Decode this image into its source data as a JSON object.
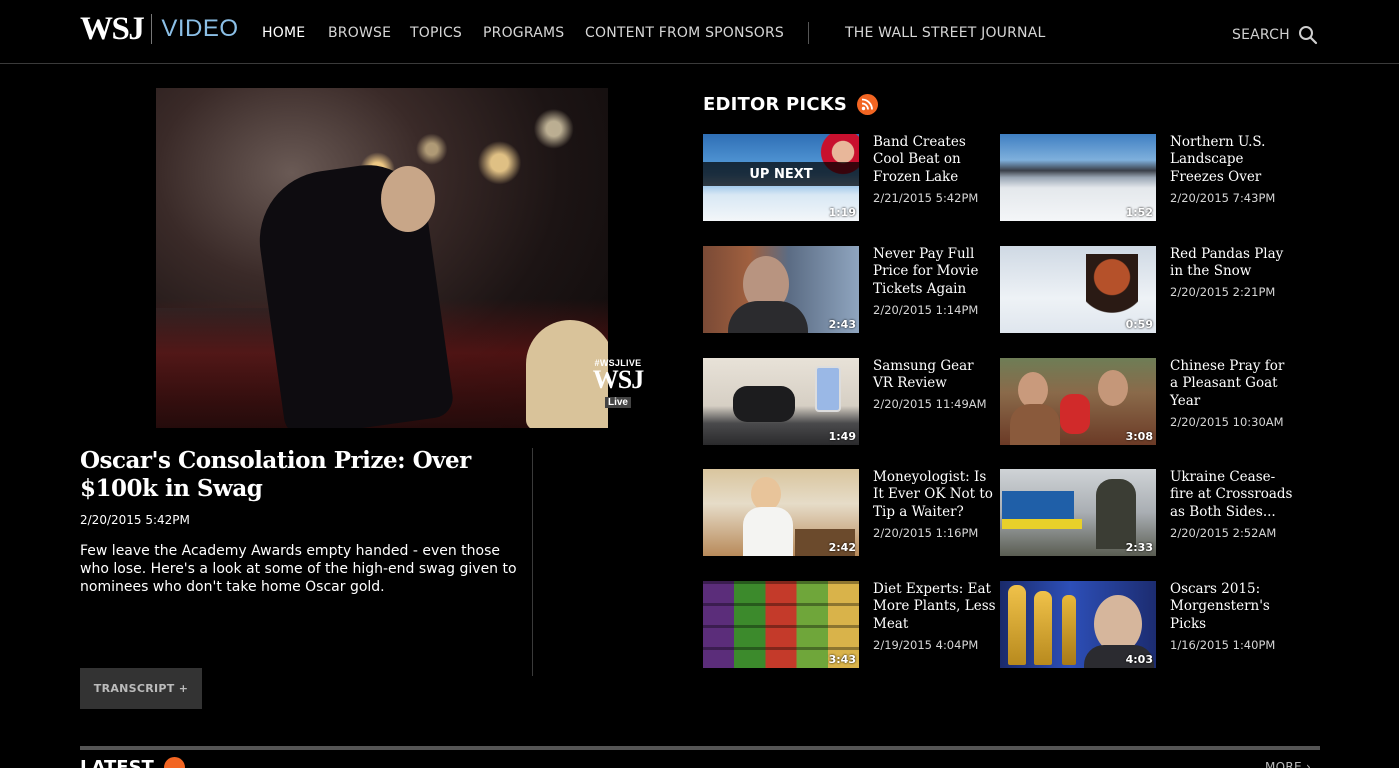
{
  "header": {
    "logo_wsj": "WSJ",
    "logo_video": "VIDEO",
    "nav": [
      {
        "label": "HOME",
        "active": true
      },
      {
        "label": "BROWSE",
        "active": false
      },
      {
        "label": "TOPICS",
        "active": false
      },
      {
        "label": "PROGRAMS",
        "active": false
      },
      {
        "label": "CONTENT FROM SPONSORS",
        "active": false
      }
    ],
    "wsj_link": "THE WALL STREET JOURNAL",
    "search_label": "SEARCH"
  },
  "player": {
    "bug_tag": "#WSJLIVE",
    "bug_logo": "WSJ",
    "bug_live": "Live"
  },
  "feature": {
    "title": "Oscar's Consolation Prize: Over $100k in Swag",
    "date": "2/20/2015 5:42PM",
    "description": "Few leave the Academy Awards empty handed - even those who lose. Here's a look at some of the high-end swag given to nominees who don't take home Oscar gold.",
    "transcript_label": "TRANSCRIPT +"
  },
  "editor_picks": {
    "title": "EDITOR PICKS",
    "up_next_label": "UP NEXT",
    "items": [
      {
        "title": "Band Creates Cool Beat on Frozen Lake",
        "date": "2/21/2015 5:42PM",
        "duration": "1:19"
      },
      {
        "title": "Northern U.S. Landscape Freezes Over",
        "date": "2/20/2015 7:43PM",
        "duration": "1:52"
      },
      {
        "title": "Never Pay Full Price for Movie Tickets Again",
        "date": "2/20/2015 1:14PM",
        "duration": "2:43"
      },
      {
        "title": "Red Pandas Play in the Snow",
        "date": "2/20/2015 2:21PM",
        "duration": "0:59"
      },
      {
        "title": "Samsung Gear VR Review",
        "date": "2/20/2015 11:49AM",
        "duration": "1:49"
      },
      {
        "title": "Chinese Pray for a Pleasant Goat Year",
        "date": "2/20/2015 10:30AM",
        "duration": "3:08"
      },
      {
        "title": "Moneyologist: Is It Ever OK Not to Tip a Waiter?",
        "date": "2/20/2015 1:16PM",
        "duration": "2:42"
      },
      {
        "title": "Ukraine Cease-fire at Crossroads as Both Sides...",
        "date": "2/20/2015 2:52AM",
        "duration": "2:33"
      },
      {
        "title": "Diet Experts: Eat More Plants, Less Meat",
        "date": "2/19/2015 4:04PM",
        "duration": "3:43"
      },
      {
        "title": "Oscars 2015: Morgenstern's Picks",
        "date": "1/16/2015 1:40PM",
        "duration": "4:03"
      }
    ]
  },
  "latest": {
    "title": "LATEST",
    "more_label": "MORE ›"
  },
  "colors": {
    "background": "#000000",
    "logo_video": "#8bbfe6",
    "rss": "#f26522",
    "transcript_bg": "#333333"
  }
}
